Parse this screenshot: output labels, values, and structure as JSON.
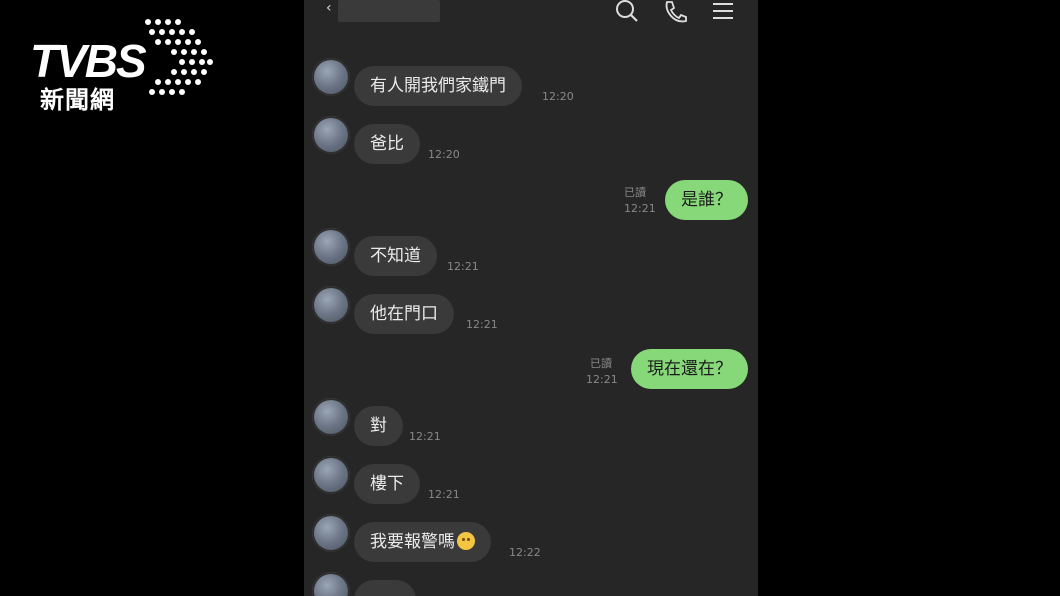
{
  "channel": {
    "logo_text": "TVBS",
    "logo_sub": "新聞網"
  },
  "chat": {
    "back_glyph": "‹",
    "icons": [
      "search-icon",
      "phone-icon",
      "menu-icon"
    ],
    "messages": [
      {
        "side": "in",
        "text": "有人開我們家鐵門",
        "time": "12:20"
      },
      {
        "side": "in",
        "text": "爸比",
        "time": "12:20"
      },
      {
        "side": "out",
        "text": "是誰？",
        "time": "12:21",
        "read": "已讀"
      },
      {
        "side": "in",
        "text": "不知道",
        "time": "12:21"
      },
      {
        "side": "in",
        "text": "他在門口",
        "time": "12:21"
      },
      {
        "side": "out",
        "text": "現在還在？",
        "time": "12:21",
        "read": "已讀"
      },
      {
        "side": "in",
        "text": "對",
        "time": "12:21"
      },
      {
        "side": "in",
        "text": "樓下",
        "time": "12:21"
      },
      {
        "side": "in",
        "text": "我要報警嗎",
        "time": "12:22",
        "emoji": "worried-face-emoji"
      }
    ]
  },
  "colors": {
    "outgoing_bubble": "#86d879",
    "incoming_bubble": "#3a3a3a",
    "chat_bg": "#262626"
  }
}
